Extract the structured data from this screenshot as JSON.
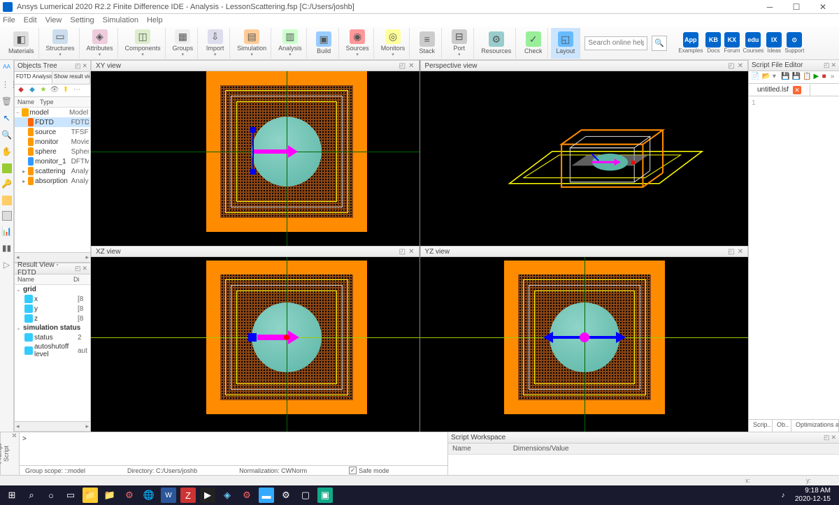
{
  "window": {
    "title": "Ansys Lumerical 2020 R2.2 Finite Difference IDE - Analysis - LessonScattering.fsp [C:/Users/joshb]"
  },
  "menu": {
    "items": [
      "File",
      "Edit",
      "View",
      "Setting",
      "Simulation",
      "Help"
    ]
  },
  "ribbon": {
    "buttons": [
      "Materials",
      "Structures",
      "Attributes",
      "Components",
      "Groups",
      "Import",
      "Simulation",
      "Analysis",
      "Build",
      "Sources",
      "Monitors",
      "Stack",
      "Port",
      "Resources",
      "Check",
      "Layout"
    ],
    "search_placeholder": "Search online help",
    "help_buttons": [
      "App",
      "KB",
      "KX",
      "edu",
      "IX",
      "Support"
    ],
    "help_labels": [
      "Examples",
      "Docs",
      "Forum",
      "Courses",
      "Ideas",
      "Support"
    ]
  },
  "objects_tree": {
    "title": "Objects Tree",
    "tabs": [
      "FDTD Analysis",
      "Show result view"
    ],
    "cols": [
      "Name",
      "Type"
    ],
    "rows": [
      {
        "name": "model",
        "type": "Model",
        "icon": "#ffaa00",
        "indent": 0,
        "exp": "−"
      },
      {
        "name": "FDTD",
        "type": "FDTD",
        "icon": "#ff6600",
        "indent": 1,
        "sel": true
      },
      {
        "name": "source",
        "type": "TFSFSou",
        "icon": "#ff9900",
        "indent": 1
      },
      {
        "name": "monitor",
        "type": "MovieM",
        "icon": "#ff9900",
        "indent": 1
      },
      {
        "name": "sphere",
        "type": "Sphere",
        "icon": "#ff9900",
        "indent": 1
      },
      {
        "name": "monitor_1",
        "type": "DFTMo",
        "icon": "#3399ff",
        "indent": 1
      },
      {
        "name": "scattering",
        "type": "Analysis",
        "icon": "#ff9900",
        "indent": 1,
        "exp": "▸"
      },
      {
        "name": "absorption",
        "type": "Analysis",
        "icon": "#ff9900",
        "indent": 1,
        "exp": "▸"
      }
    ]
  },
  "result_view": {
    "title": "Result View - FDTD",
    "cols": [
      "Name",
      "Di"
    ],
    "groups": [
      {
        "name": "grid",
        "items": [
          {
            "name": "x",
            "val": "[8"
          },
          {
            "name": "y",
            "val": "[8"
          },
          {
            "name": "z",
            "val": "[8"
          }
        ]
      },
      {
        "name": "simulation status",
        "items": [
          {
            "name": "status",
            "val": "2"
          },
          {
            "name": "autoshutoff level",
            "val": "aut"
          }
        ]
      }
    ]
  },
  "views": {
    "xy": "XY view",
    "persp": "Perspective view",
    "xz": "XZ view",
    "yz": "YZ view"
  },
  "script_editor": {
    "title": "Script File Editor",
    "tab": "untitled.lsf",
    "line": "1"
  },
  "right_tabs": [
    "Scrip..",
    "Ob..",
    "Optimizations a.."
  ],
  "script_prompt": {
    "label": "Script Prompt",
    "prompt": ">",
    "status": {
      "scope": "Group scope: ::model",
      "dir": "Directory: C:/Users/joshb",
      "norm": "Normalization: CWNorm",
      "safe": "Safe mode"
    }
  },
  "script_workspace": {
    "title": "Script Workspace",
    "cols": [
      "Name",
      "Dimensions/Value"
    ]
  },
  "statusbar": {
    "x": "x:",
    "y": "y:"
  },
  "taskbar": {
    "time": "9:18 AM",
    "date": "2020-12-15"
  }
}
